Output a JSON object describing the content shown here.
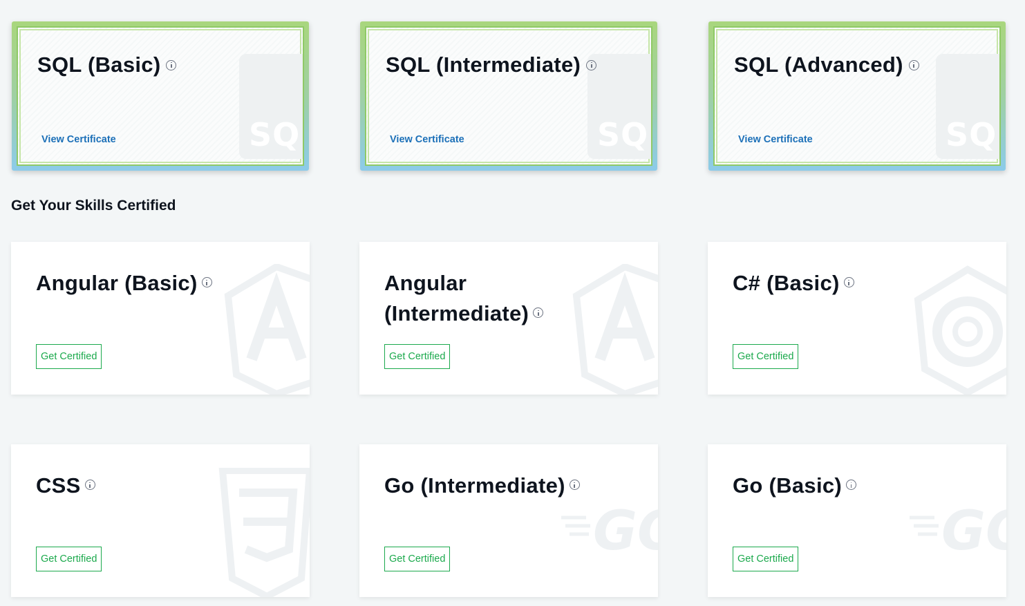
{
  "earned": [
    {
      "title": "SQL (Basic)",
      "link": "View Certificate",
      "badge": "SQL"
    },
    {
      "title": "SQL (Intermediate)",
      "link": "View Certificate",
      "badge": "SQL"
    },
    {
      "title": "SQL (Advanced)",
      "link": "View Certificate",
      "badge": "SQL"
    }
  ],
  "section_title": "Get Your Skills Certified",
  "skills": [
    {
      "title": "Angular (Basic)",
      "button": "Get Certified",
      "icon": "angular-icon"
    },
    {
      "title": "Angular (Intermediate)",
      "button": "Get Certified",
      "icon": "angular-icon"
    },
    {
      "title": "C# (Basic)",
      "button": "Get Certified",
      "icon": "csharp-icon"
    },
    {
      "title": "CSS",
      "button": "Get Certified",
      "icon": "css3-icon"
    },
    {
      "title": "Go (Intermediate)",
      "button": "Get Certified",
      "icon": "go-icon"
    },
    {
      "title": "Go (Basic)",
      "button": "Get Certified",
      "icon": "go-icon"
    }
  ],
  "colors": {
    "accent_green": "#1ba94c",
    "link_blue": "#1c70b8",
    "background": "#f3f6f7"
  }
}
